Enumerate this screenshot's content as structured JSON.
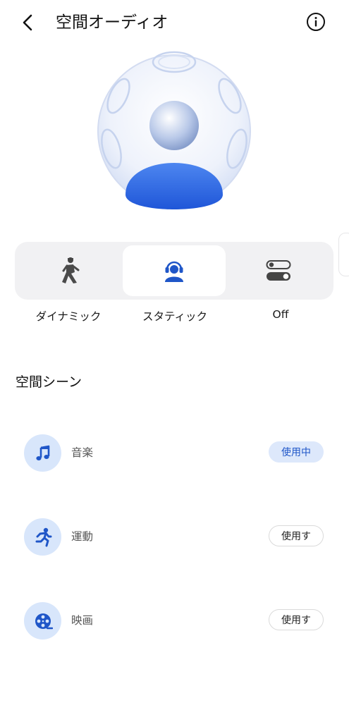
{
  "header": {
    "title": "空間オーディオ"
  },
  "modes": [
    {
      "label": "ダイナミック",
      "icon": "walking-person-icon",
      "selected": false
    },
    {
      "label": "スタティック",
      "icon": "person-headphones-icon",
      "selected": true
    },
    {
      "label": "Off",
      "icon": "toggle-switches-icon",
      "selected": false
    }
  ],
  "scenes": {
    "title": "空間シーン",
    "items": [
      {
        "label": "音楽",
        "icon": "music-note-icon",
        "action": "使用中",
        "active": true
      },
      {
        "label": "運動",
        "icon": "running-person-icon",
        "action": "使用す",
        "active": false
      },
      {
        "label": "映画",
        "icon": "film-reel-icon",
        "action": "使用す",
        "active": false
      }
    ]
  },
  "colors": {
    "accent": "#1f56c8",
    "icon_bg": "#d8e6fb",
    "tray_bg": "#f1f1f3"
  }
}
